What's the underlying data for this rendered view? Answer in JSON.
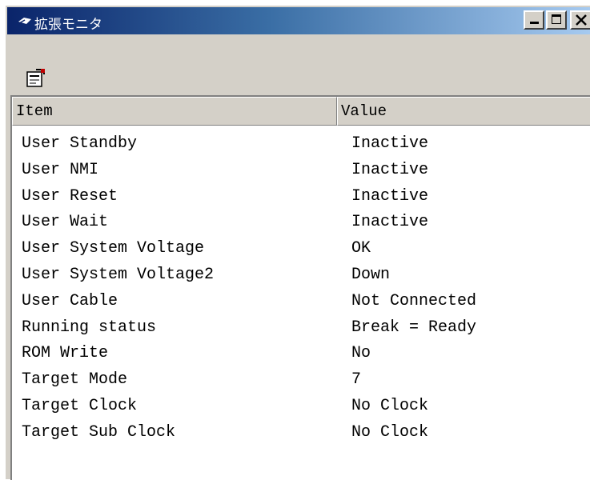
{
  "window": {
    "title": "拡張モニタ",
    "icon": "app-chip-icon",
    "controls": {
      "minimize": "minimize-button",
      "maximize": "maximize-button",
      "close": "close-button"
    }
  },
  "toolbar": {
    "properties_icon": "properties-icon"
  },
  "table": {
    "columns": [
      "Item",
      "Value"
    ],
    "rows": [
      {
        "item": "User Standby",
        "value": "Inactive"
      },
      {
        "item": "User NMI",
        "value": "Inactive"
      },
      {
        "item": "User Reset",
        "value": "Inactive"
      },
      {
        "item": "User Wait",
        "value": "Inactive"
      },
      {
        "item": "User System Voltage",
        "value": "OK"
      },
      {
        "item": "User System Voltage2",
        "value": "Down"
      },
      {
        "item": "User Cable",
        "value": "Not Connected"
      },
      {
        "item": "Running status",
        "value": "Break = Ready"
      },
      {
        "item": "ROM Write",
        "value": "No"
      },
      {
        "item": "Target Mode",
        "value": "7"
      },
      {
        "item": "Target Clock",
        "value": "No Clock"
      },
      {
        "item": "Target Sub Clock",
        "value": "No Clock"
      }
    ]
  },
  "colors": {
    "title_start": "#0a246a",
    "title_end": "#a6caf0",
    "face": "#d4d0c8"
  }
}
